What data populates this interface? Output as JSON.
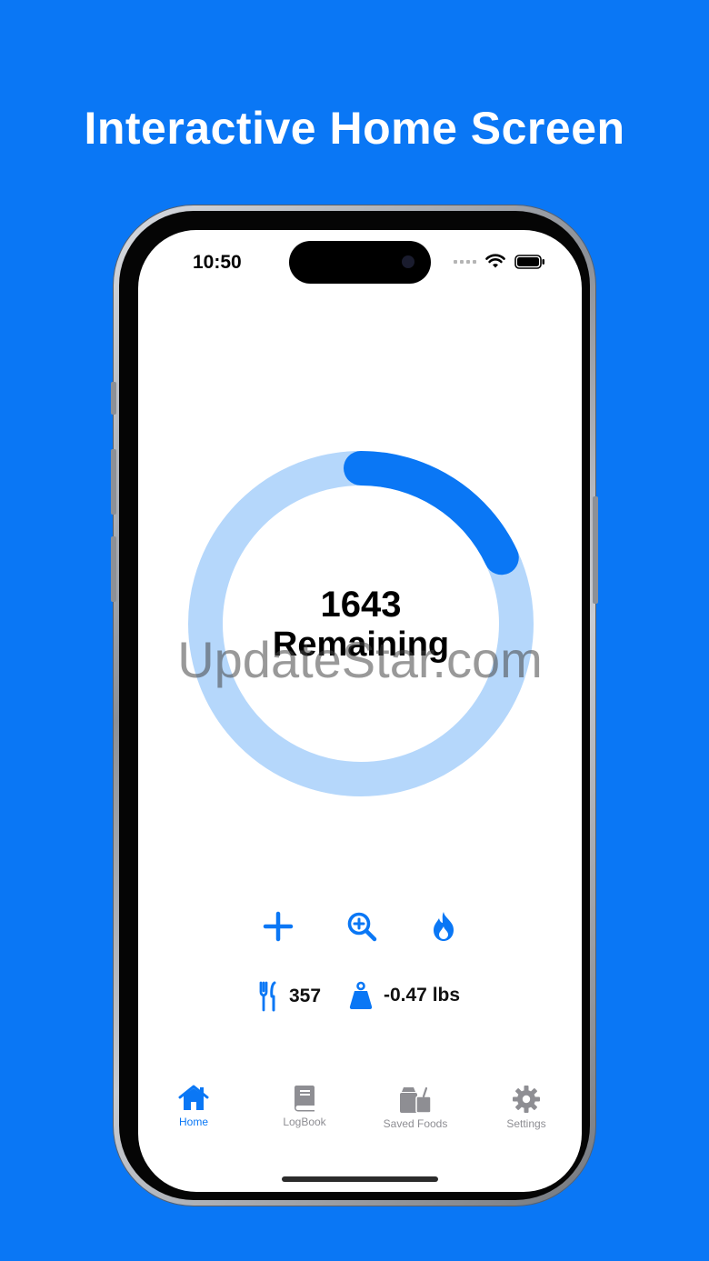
{
  "headline": "Interactive Home Screen",
  "status_bar": {
    "time": "10:50"
  },
  "ring": {
    "value": "1643",
    "label": "Remaining",
    "progress_fraction": 0.18,
    "track_color": "#b5d7fb",
    "fill_color": "#0a77f5"
  },
  "watermark": "UpdateStar.com",
  "actions": [
    {
      "icon": "plus-icon"
    },
    {
      "icon": "zoom-in-icon"
    },
    {
      "icon": "flame-icon"
    }
  ],
  "stats": {
    "food": {
      "icon": "fork-knife-icon",
      "value": "357"
    },
    "weight": {
      "icon": "weight-icon",
      "value": "-0.47 lbs"
    }
  },
  "tabs": [
    {
      "label": "Home",
      "icon": "house-icon",
      "active": true
    },
    {
      "label": "LogBook",
      "icon": "book-icon",
      "active": false
    },
    {
      "label": "Saved Foods",
      "icon": "bag-icon",
      "active": false
    },
    {
      "label": "Settings",
      "icon": "gear-icon",
      "active": false
    }
  ],
  "colors": {
    "background": "#0a77f5",
    "accent": "#0a77f5",
    "inactive": "#8e8e93"
  }
}
